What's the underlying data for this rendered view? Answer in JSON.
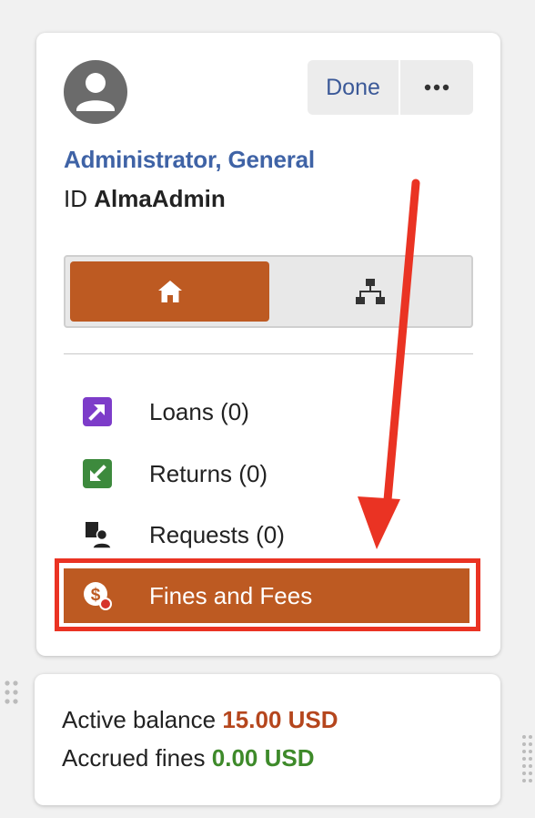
{
  "user": {
    "name": "Administrator, General",
    "id_label": "ID",
    "id_value": "AlmaAdmin"
  },
  "actions": {
    "done_label": "Done",
    "more_icon": "more-horizontal-icon"
  },
  "view_toggle": {
    "home_icon": "home-icon",
    "hierarchy_icon": "sitemap-icon",
    "selected": "home"
  },
  "menu": {
    "items": [
      {
        "label": "Loans",
        "count": "(0)",
        "icon": "loan-arrow-icon",
        "icon_color": "#7d3cc9"
      },
      {
        "label": "Returns",
        "count": "(0)",
        "icon": "return-arrow-icon",
        "icon_color": "#3d8a3d"
      },
      {
        "label": "Requests",
        "count": "(0)",
        "icon": "requests-icon",
        "icon_color": "#222222"
      },
      {
        "label": "Fines and Fees",
        "count": "",
        "icon": "fines-dollar-icon",
        "icon_color": "#ffffff",
        "active": true
      }
    ]
  },
  "balance": {
    "active_label": "Active balance",
    "active_value": "15.00 USD",
    "accrued_label": "Accrued fines",
    "accrued_value": "0.00 USD"
  },
  "colors": {
    "accent": "#bd5a22",
    "link": "#3f63a6",
    "annotation": "#ea3323",
    "amount_due": "#b5461d",
    "amount_ok": "#3e8a2a"
  }
}
